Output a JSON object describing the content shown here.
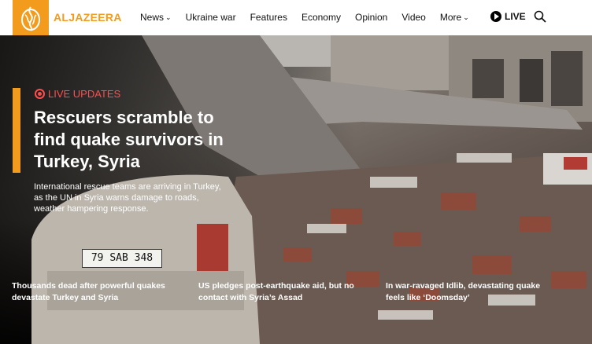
{
  "brand": {
    "name": "ALJAZEERA",
    "accent": "#f29b1d"
  },
  "nav": {
    "items": [
      {
        "label": "News",
        "dropdown": true
      },
      {
        "label": "Ukraine war",
        "dropdown": false
      },
      {
        "label": "Features",
        "dropdown": false
      },
      {
        "label": "Economy",
        "dropdown": false
      },
      {
        "label": "Opinion",
        "dropdown": false
      },
      {
        "label": "Video",
        "dropdown": false
      },
      {
        "label": "More",
        "dropdown": true
      }
    ],
    "live_label": "LIVE",
    "search_icon": "search-icon"
  },
  "hero": {
    "tag": "LIVE UPDATES",
    "headline": "Rescuers scramble to find quake survivors in Turkey, Syria",
    "summary": "International rescue teams are arriving in Turkey, as the UN in Syria warns damage to roads, weather hampering response.",
    "plate": "79 SAB 348"
  },
  "stories": [
    {
      "title": "Thousands dead after powerful quakes devastate Turkey and Syria"
    },
    {
      "title": "US pledges post-earthquake aid, but no contact with Syria’s Assad"
    },
    {
      "title": "In war-ravaged Idlib, devastating quake feels like ‘Doomsday’"
    }
  ]
}
